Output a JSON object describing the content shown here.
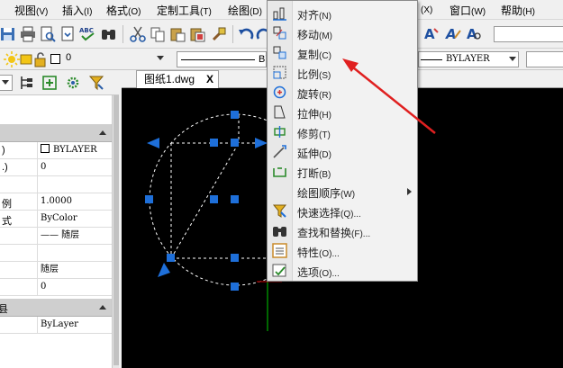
{
  "menubar": {
    "items": [
      {
        "label": "视图",
        "key": "(V)"
      },
      {
        "label": "插入",
        "key": "(I)"
      },
      {
        "label": "格式",
        "key": "(O)"
      },
      {
        "label": "定制工具",
        "key": "(T)"
      },
      {
        "label": "绘图",
        "key": "(D)"
      },
      {
        "label": "",
        "key": "(X)"
      },
      {
        "label": "窗口",
        "key": "(W)"
      },
      {
        "label": "帮助",
        "key": "(H)"
      }
    ]
  },
  "toolbar2": {
    "layer_name": "0",
    "linetype_right": "BYLAYER",
    "linetype_left_partial": "BY"
  },
  "properties": {
    "rows": [
      {
        "k": ")",
        "v": "BYLAYER"
      },
      {
        "k": ".)",
        "v": "0"
      },
      {
        "k": "",
        "v": ""
      },
      {
        "k": "例",
        "v": "1.0000"
      },
      {
        "k": "式",
        "v": "ByColor"
      },
      {
        "k": "",
        "v": "—— 随层"
      },
      {
        "k": "",
        "v": ""
      },
      {
        "k": "",
        "v": "随层"
      },
      {
        "k": "",
        "v": "0"
      },
      {
        "k": "",
        "v": "ByLayer"
      }
    ],
    "section2_label": "县"
  },
  "document_tab": {
    "title": "图纸1.dwg",
    "close": "X"
  },
  "context_menu": {
    "items": [
      {
        "label": "对齐",
        "key": "(N)",
        "icon": "align-icon"
      },
      {
        "label": "移动",
        "key": "(M)",
        "icon": "move-icon"
      },
      {
        "label": "复制",
        "key": "(C)",
        "icon": "copy-icon"
      },
      {
        "label": "比例",
        "key": "(S)",
        "icon": "scale-icon"
      },
      {
        "label": "旋转",
        "key": "(R)",
        "icon": "rotate-icon"
      },
      {
        "label": "拉伸",
        "key": "(H)",
        "icon": "stretch-icon"
      },
      {
        "label": "修剪",
        "key": "(T)",
        "icon": "trim-icon"
      },
      {
        "label": "延伸",
        "key": "(D)",
        "icon": "extend-icon"
      },
      {
        "label": "打断",
        "key": "(B)",
        "icon": "break-icon"
      },
      {
        "label": "绘图顺序",
        "key": "(W)",
        "icon": "",
        "submenu": true
      },
      {
        "label": "快速选择",
        "key": "(Q)...",
        "icon": "quick-select-icon"
      },
      {
        "label": "查找和替换",
        "key": "(F)...",
        "icon": "find-replace-icon"
      },
      {
        "label": "特性",
        "key": "(O)...",
        "icon": "properties-icon"
      },
      {
        "label": "选项",
        "key": "(O)...",
        "icon": "options-icon"
      }
    ]
  },
  "colors": {
    "accent": "#1e6fd9",
    "annotation_arrow": "#e02020",
    "canvas": "#000000",
    "grip": "#1e6fd9"
  }
}
